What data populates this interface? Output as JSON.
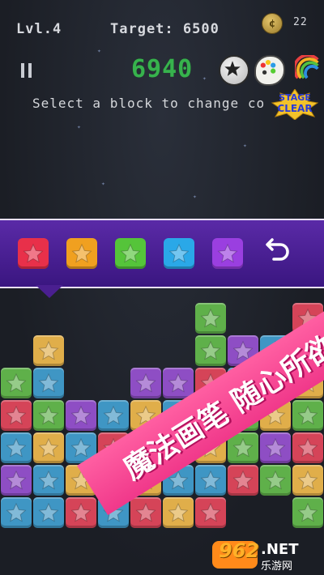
{
  "hud": {
    "level": "Lvl.4",
    "target": "Target: 6500",
    "coins": "22",
    "score": "6940",
    "hint": "Select a block to change co"
  },
  "badge": {
    "text_top": "STAGE",
    "text_bottom": "CLEAR"
  },
  "tools": [
    "bomb-icon",
    "palette-icon",
    "rainbow-icon"
  ],
  "palette": {
    "colors": [
      {
        "name": "red",
        "fill": "#e8304a"
      },
      {
        "name": "orange",
        "fill": "#f0a020"
      },
      {
        "name": "green",
        "fill": "#55c43a"
      },
      {
        "name": "blue",
        "fill": "#2aa8e8"
      },
      {
        "name": "purple",
        "fill": "#9a3fe0"
      }
    ],
    "undo_icon": "undo-icon"
  },
  "board": {
    "colors": {
      "R": "#d54458",
      "O": "#e0ae4a",
      "G": "#5fb04a",
      "B": "#3f96c4",
      "P": "#8e4ec4"
    },
    "rows": [
      "......G..R",
      ".O....GPBP",
      "GB..PPRBRO",
      "RGPBOBRGOG",
      "BOBRPGOGPR",
      "PBOPOBBRGO",
      "BBRBROR..G"
    ]
  },
  "ribbon": {
    "text": "魔法画笔  随心所欲"
  },
  "watermark": {
    "number": "962",
    "domain": ".NET",
    "site": "乐游网"
  },
  "colors": {
    "accent_score": "#37b24d",
    "bar": "#4a1f90",
    "ribbon": "#f0388a"
  }
}
